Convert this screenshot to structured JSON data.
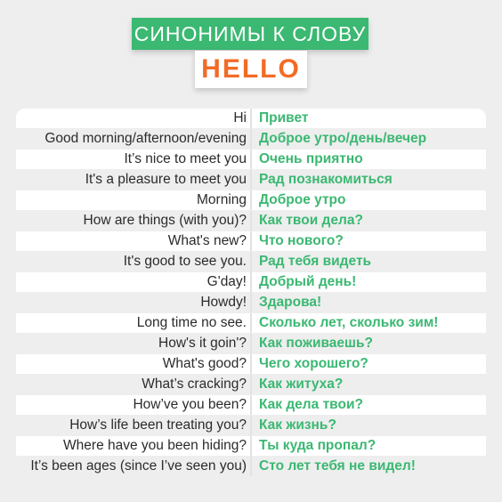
{
  "header": {
    "subtitle": "СИНОНИМЫ К СЛОВУ",
    "word": "HELLO"
  },
  "colors": {
    "accent_green": "#3bb872",
    "accent_orange": "#f26b26"
  },
  "rows": [
    {
      "en": "Hi",
      "ru": "Привет"
    },
    {
      "en": "Good morning/afternoon/evening",
      "ru": "Доброе утро/день/вечер"
    },
    {
      "en": "It’s nice to meet you",
      "ru": "Очень приятно"
    },
    {
      "en": "It's a pleasure to meet you",
      "ru": "Рад познакомиться"
    },
    {
      "en": "Morning",
      "ru": "Доброе утро"
    },
    {
      "en": "How are things (with you)?",
      "ru": "Как твои дела?"
    },
    {
      "en": "What's new?",
      "ru": "Что нового?"
    },
    {
      "en": "It's good to see you.",
      "ru": "Рад тебя видеть"
    },
    {
      "en": "G'day!",
      "ru": "Добрый день!"
    },
    {
      "en": "Howdy!",
      "ru": "Здарова!"
    },
    {
      "en": "Long time no see.",
      "ru": "Сколько лет, сколько зим!"
    },
    {
      "en": "How's it goin'?",
      "ru": "Как поживаешь?"
    },
    {
      "en": "What's good?",
      "ru": "Чего хорошего?"
    },
    {
      "en": "What’s cracking?",
      "ru": "Как житуха?"
    },
    {
      "en": "How’ve you been?",
      "ru": "Как дела твои?"
    },
    {
      "en": "How’s life been treating you?",
      "ru": "Как жизнь?"
    },
    {
      "en": "Where have you been hiding?",
      "ru": "Ты куда пропал?"
    },
    {
      "en": "It’s been ages (since I’ve seen you)",
      "ru": "Сто лет тебя не видел!"
    }
  ]
}
